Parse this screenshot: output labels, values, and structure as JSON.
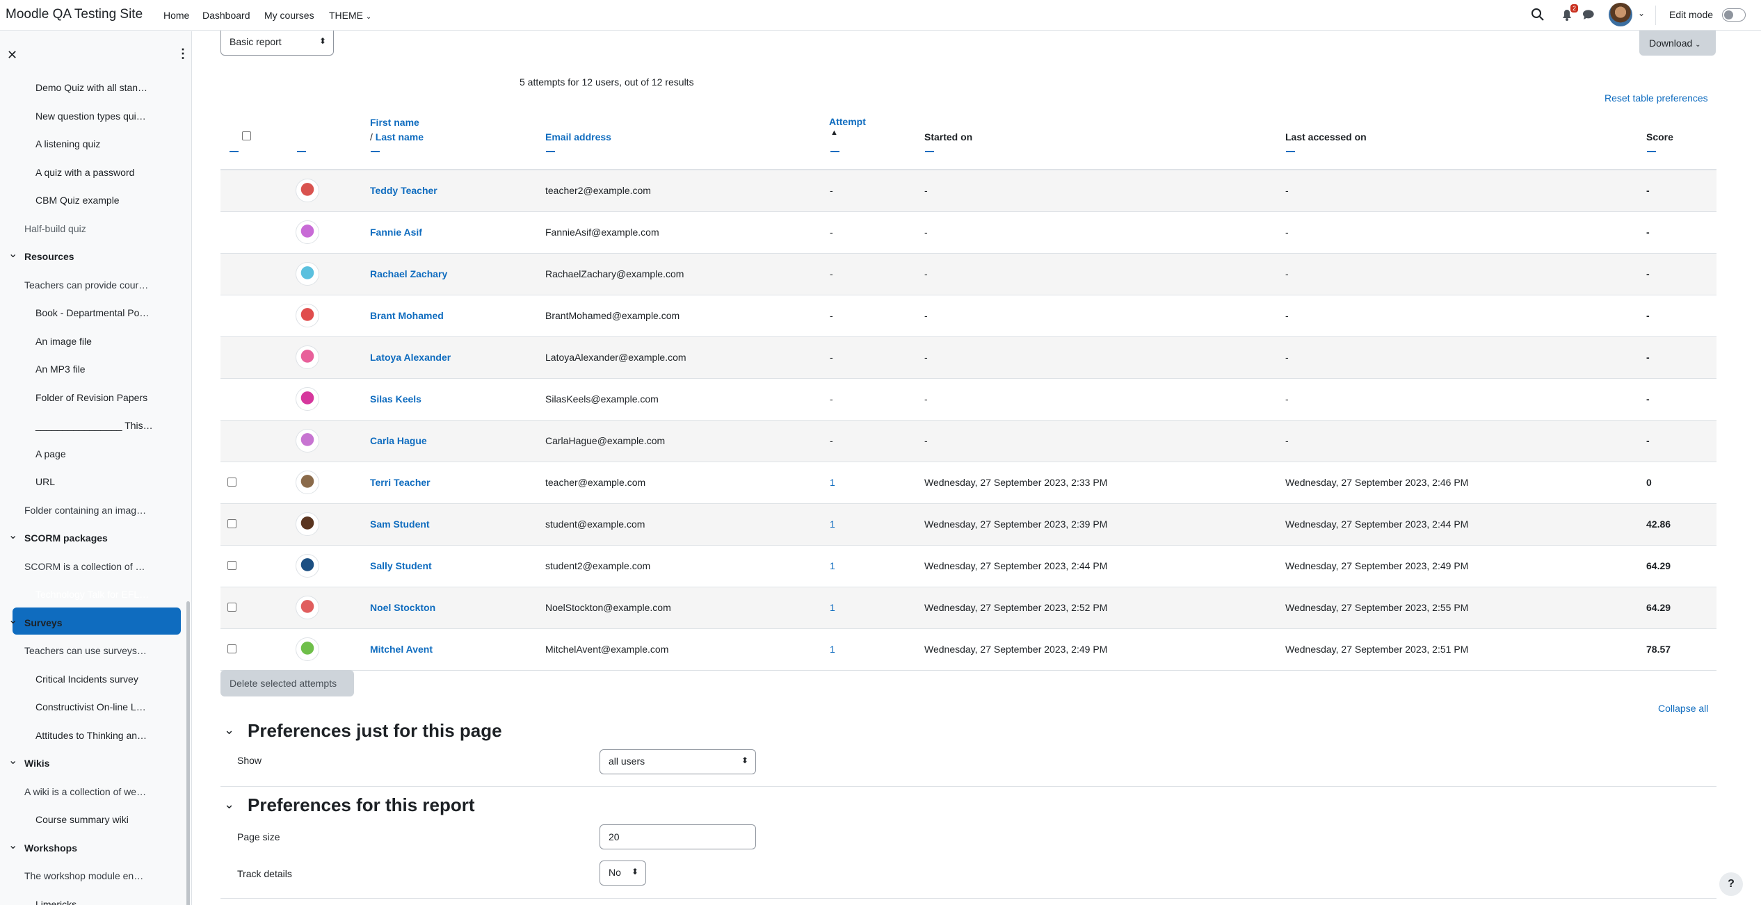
{
  "navbar": {
    "site_name": "Moodle QA Testing Site",
    "links": [
      "Home",
      "Dashboard",
      "My courses",
      "THEME"
    ],
    "notification_count": "2",
    "edit_mode_label": "Edit mode"
  },
  "drawer": {
    "items": [
      {
        "label": "Demo Quiz with all stan…",
        "level": 2
      },
      {
        "label": "New question types qui…",
        "level": 2
      },
      {
        "label": "A listening quiz",
        "level": 2
      },
      {
        "label": "A quiz with a password",
        "level": 2
      },
      {
        "label": "CBM Quiz example",
        "level": 2
      },
      {
        "label": "Half-build quiz",
        "level": 1
      },
      {
        "label": "Resources",
        "level": 0
      },
      {
        "label": "Teachers can provide cour…",
        "level": 1
      },
      {
        "label": "Book - Departmental Po…",
        "level": 2
      },
      {
        "label": "An image file",
        "level": 2
      },
      {
        "label": "An MP3 file",
        "level": 2
      },
      {
        "label": "Folder of Revision Papers",
        "level": 2
      },
      {
        "label": "________________ This…",
        "level": 2
      },
      {
        "label": "A page",
        "level": 2
      },
      {
        "label": "URL",
        "level": 2
      },
      {
        "label": "Folder containing an imag…",
        "level": 1
      },
      {
        "label": "SCORM packages",
        "level": 0
      },
      {
        "label": "SCORM is a collection of …",
        "level": 1
      },
      {
        "label": "Technology Talk for EFL…",
        "level": 2
      },
      {
        "label": "Surveys",
        "level": 0
      },
      {
        "label": "Teachers can use surveys…",
        "level": 1
      },
      {
        "label": "Critical Incidents survey",
        "level": 2
      },
      {
        "label": "Constructivist On-line L…",
        "level": 2
      },
      {
        "label": "Attitudes to Thinking an…",
        "level": 2
      },
      {
        "label": "Wikis",
        "level": 0
      },
      {
        "label": "A wiki is a collection of we…",
        "level": 1
      },
      {
        "label": "Course summary wiki",
        "level": 2
      },
      {
        "label": "Workshops",
        "level": 0
      },
      {
        "label": "The workshop module en…",
        "level": 1
      },
      {
        "label": "Limericks",
        "level": 2
      }
    ]
  },
  "report": {
    "report_select": "Basic report",
    "download_label": "Download",
    "summary": "5 attempts for 12 users, out of 12 results",
    "reset_label": "Reset table preferences",
    "headers": {
      "first_name": "First name",
      "slash": "/",
      "last_name": "Last name",
      "email": "Email address",
      "attempt": "Attempt",
      "started": "Started on",
      "last_accessed": "Last accessed on",
      "score": "Score"
    },
    "rows": [
      {
        "name": "Teddy Teacher",
        "email": "teacher2@example.com",
        "attempt": "-",
        "started": "-",
        "last": "-",
        "score": "-",
        "checkbox": false,
        "avatar": "#d9534f"
      },
      {
        "name": "Fannie Asif",
        "email": "FannieAsif@example.com",
        "attempt": "-",
        "started": "-",
        "last": "-",
        "score": "-",
        "checkbox": false,
        "avatar": "#c86bd6"
      },
      {
        "name": "Rachael Zachary",
        "email": "RachaelZachary@example.com",
        "attempt": "-",
        "started": "-",
        "last": "-",
        "score": "-",
        "checkbox": false,
        "avatar": "#5bc0de"
      },
      {
        "name": "Brant Mohamed",
        "email": "BrantMohamed@example.com",
        "attempt": "-",
        "started": "-",
        "last": "-",
        "score": "-",
        "checkbox": false,
        "avatar": "#e04d4d"
      },
      {
        "name": "Latoya Alexander",
        "email": "LatoyaAlexander@example.com",
        "attempt": "-",
        "started": "-",
        "last": "-",
        "score": "-",
        "checkbox": false,
        "avatar": "#e8609a"
      },
      {
        "name": "Silas Keels",
        "email": "SilasKeels@example.com",
        "attempt": "-",
        "started": "-",
        "last": "-",
        "score": "-",
        "checkbox": false,
        "avatar": "#d6379d"
      },
      {
        "name": "Carla Hague",
        "email": "CarlaHague@example.com",
        "attempt": "-",
        "started": "-",
        "last": "-",
        "score": "-",
        "checkbox": false,
        "avatar": "#c774d1"
      },
      {
        "name": "Terri Teacher",
        "email": "teacher@example.com",
        "attempt": "1",
        "started": "Wednesday, 27 September 2023, 2:33 PM",
        "last": "Wednesday, 27 September 2023, 2:46 PM",
        "score": "0",
        "checkbox": true,
        "avatar": "#8a6a4a"
      },
      {
        "name": "Sam Student",
        "email": "student@example.com",
        "attempt": "1",
        "started": "Wednesday, 27 September 2023, 2:39 PM",
        "last": "Wednesday, 27 September 2023, 2:44 PM",
        "score": "42.86",
        "checkbox": true,
        "avatar": "#5a3520"
      },
      {
        "name": "Sally Student",
        "email": "student2@example.com",
        "attempt": "1",
        "started": "Wednesday, 27 September 2023, 2:44 PM",
        "last": "Wednesday, 27 September 2023, 2:49 PM",
        "score": "64.29",
        "checkbox": true,
        "avatar": "#1c4f82"
      },
      {
        "name": "Noel Stockton",
        "email": "NoelStockton@example.com",
        "attempt": "1",
        "started": "Wednesday, 27 September 2023, 2:52 PM",
        "last": "Wednesday, 27 September 2023, 2:55 PM",
        "score": "64.29",
        "checkbox": true,
        "avatar": "#e05d5d"
      },
      {
        "name": "Mitchel Avent",
        "email": "MitchelAvent@example.com",
        "attempt": "1",
        "started": "Wednesday, 27 September 2023, 2:49 PM",
        "last": "Wednesday, 27 September 2023, 2:51 PM",
        "score": "78.57",
        "checkbox": true,
        "avatar": "#6fbf4a"
      }
    ],
    "delete_label": "Delete selected attempts",
    "collapse_all": "Collapse all"
  },
  "prefs_page": {
    "title": "Preferences just for this page",
    "show_label": "Show",
    "show_value": "all users"
  },
  "prefs_report": {
    "title": "Preferences for this report",
    "page_size_label": "Page size",
    "page_size_value": "20",
    "track_label": "Track details",
    "track_value": "No"
  },
  "colors": {
    "link": "#0f6cbf",
    "active": "#0f6cbf"
  }
}
